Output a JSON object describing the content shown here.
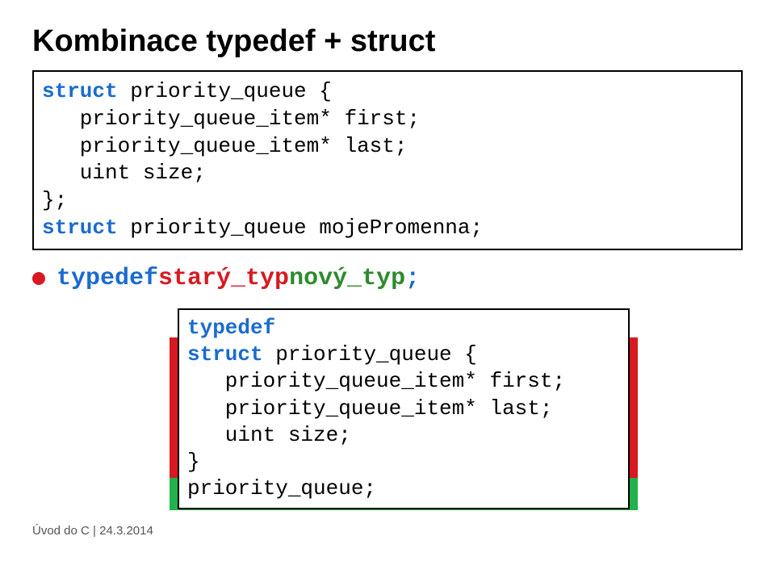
{
  "title": "Kombinace typedef + struct",
  "code1": {
    "l1a": "struct",
    "l1b": " priority_queue {",
    "l2": "   priority_queue_item* first;",
    "l3": "   priority_queue_item* last;",
    "l4": "   uint size;",
    "l5": "};",
    "l6a": "struct",
    "l6b": " priority_queue mojePromenna;"
  },
  "bullet": {
    "kw": "typedef",
    "old": " starý_typ ",
    "new": "nový_typ",
    "semi": ";"
  },
  "code2": {
    "l1": "typedef",
    "l2a": "struct",
    "l2b": " priority_queue {",
    "l3": "   priority_queue_item* first;",
    "l4": "   priority_queue_item* last;",
    "l5": "   uint size;",
    "l6": "}",
    "l7": "priority_queue;"
  },
  "footer": "Úvod do C | 24.3.2014"
}
